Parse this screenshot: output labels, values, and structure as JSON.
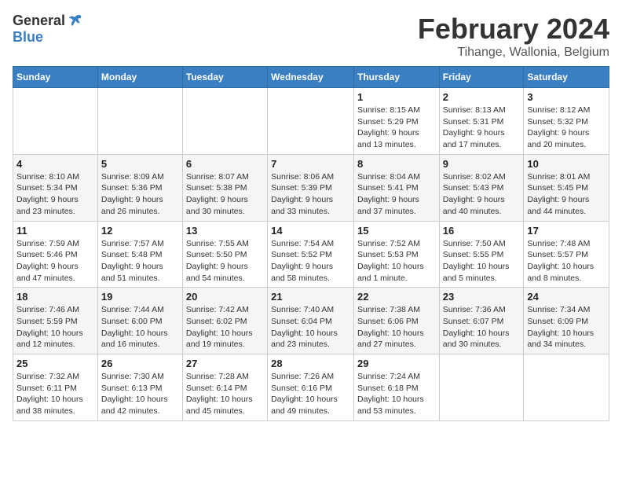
{
  "header": {
    "logo_general": "General",
    "logo_blue": "Blue",
    "title": "February 2024",
    "subtitle": "Tihange, Wallonia, Belgium"
  },
  "columns": [
    "Sunday",
    "Monday",
    "Tuesday",
    "Wednesday",
    "Thursday",
    "Friday",
    "Saturday"
  ],
  "weeks": [
    [
      {
        "day": "",
        "info": ""
      },
      {
        "day": "",
        "info": ""
      },
      {
        "day": "",
        "info": ""
      },
      {
        "day": "",
        "info": ""
      },
      {
        "day": "1",
        "info": "Sunrise: 8:15 AM\nSunset: 5:29 PM\nDaylight: 9 hours\nand 13 minutes."
      },
      {
        "day": "2",
        "info": "Sunrise: 8:13 AM\nSunset: 5:31 PM\nDaylight: 9 hours\nand 17 minutes."
      },
      {
        "day": "3",
        "info": "Sunrise: 8:12 AM\nSunset: 5:32 PM\nDaylight: 9 hours\nand 20 minutes."
      }
    ],
    [
      {
        "day": "4",
        "info": "Sunrise: 8:10 AM\nSunset: 5:34 PM\nDaylight: 9 hours\nand 23 minutes."
      },
      {
        "day": "5",
        "info": "Sunrise: 8:09 AM\nSunset: 5:36 PM\nDaylight: 9 hours\nand 26 minutes."
      },
      {
        "day": "6",
        "info": "Sunrise: 8:07 AM\nSunset: 5:38 PM\nDaylight: 9 hours\nand 30 minutes."
      },
      {
        "day": "7",
        "info": "Sunrise: 8:06 AM\nSunset: 5:39 PM\nDaylight: 9 hours\nand 33 minutes."
      },
      {
        "day": "8",
        "info": "Sunrise: 8:04 AM\nSunset: 5:41 PM\nDaylight: 9 hours\nand 37 minutes."
      },
      {
        "day": "9",
        "info": "Sunrise: 8:02 AM\nSunset: 5:43 PM\nDaylight: 9 hours\nand 40 minutes."
      },
      {
        "day": "10",
        "info": "Sunrise: 8:01 AM\nSunset: 5:45 PM\nDaylight: 9 hours\nand 44 minutes."
      }
    ],
    [
      {
        "day": "11",
        "info": "Sunrise: 7:59 AM\nSunset: 5:46 PM\nDaylight: 9 hours\nand 47 minutes."
      },
      {
        "day": "12",
        "info": "Sunrise: 7:57 AM\nSunset: 5:48 PM\nDaylight: 9 hours\nand 51 minutes."
      },
      {
        "day": "13",
        "info": "Sunrise: 7:55 AM\nSunset: 5:50 PM\nDaylight: 9 hours\nand 54 minutes."
      },
      {
        "day": "14",
        "info": "Sunrise: 7:54 AM\nSunset: 5:52 PM\nDaylight: 9 hours\nand 58 minutes."
      },
      {
        "day": "15",
        "info": "Sunrise: 7:52 AM\nSunset: 5:53 PM\nDaylight: 10 hours\nand 1 minute."
      },
      {
        "day": "16",
        "info": "Sunrise: 7:50 AM\nSunset: 5:55 PM\nDaylight: 10 hours\nand 5 minutes."
      },
      {
        "day": "17",
        "info": "Sunrise: 7:48 AM\nSunset: 5:57 PM\nDaylight: 10 hours\nand 8 minutes."
      }
    ],
    [
      {
        "day": "18",
        "info": "Sunrise: 7:46 AM\nSunset: 5:59 PM\nDaylight: 10 hours\nand 12 minutes."
      },
      {
        "day": "19",
        "info": "Sunrise: 7:44 AM\nSunset: 6:00 PM\nDaylight: 10 hours\nand 16 minutes."
      },
      {
        "day": "20",
        "info": "Sunrise: 7:42 AM\nSunset: 6:02 PM\nDaylight: 10 hours\nand 19 minutes."
      },
      {
        "day": "21",
        "info": "Sunrise: 7:40 AM\nSunset: 6:04 PM\nDaylight: 10 hours\nand 23 minutes."
      },
      {
        "day": "22",
        "info": "Sunrise: 7:38 AM\nSunset: 6:06 PM\nDaylight: 10 hours\nand 27 minutes."
      },
      {
        "day": "23",
        "info": "Sunrise: 7:36 AM\nSunset: 6:07 PM\nDaylight: 10 hours\nand 30 minutes."
      },
      {
        "day": "24",
        "info": "Sunrise: 7:34 AM\nSunset: 6:09 PM\nDaylight: 10 hours\nand 34 minutes."
      }
    ],
    [
      {
        "day": "25",
        "info": "Sunrise: 7:32 AM\nSunset: 6:11 PM\nDaylight: 10 hours\nand 38 minutes."
      },
      {
        "day": "26",
        "info": "Sunrise: 7:30 AM\nSunset: 6:13 PM\nDaylight: 10 hours\nand 42 minutes."
      },
      {
        "day": "27",
        "info": "Sunrise: 7:28 AM\nSunset: 6:14 PM\nDaylight: 10 hours\nand 45 minutes."
      },
      {
        "day": "28",
        "info": "Sunrise: 7:26 AM\nSunset: 6:16 PM\nDaylight: 10 hours\nand 49 minutes."
      },
      {
        "day": "29",
        "info": "Sunrise: 7:24 AM\nSunset: 6:18 PM\nDaylight: 10 hours\nand 53 minutes."
      },
      {
        "day": "",
        "info": ""
      },
      {
        "day": "",
        "info": ""
      }
    ]
  ]
}
